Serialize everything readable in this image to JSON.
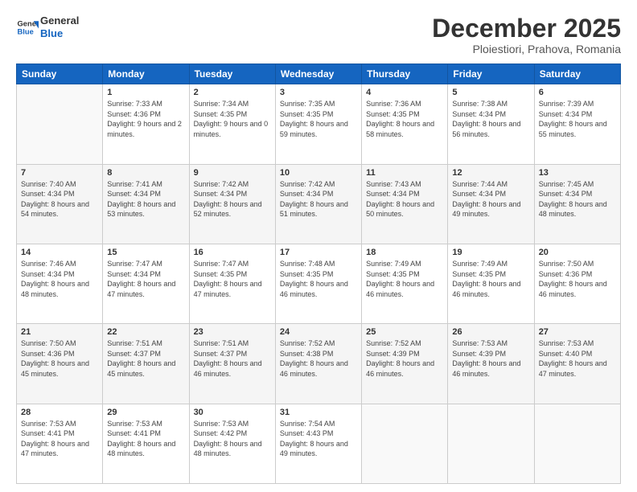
{
  "header": {
    "logo_line1": "General",
    "logo_line2": "Blue",
    "month": "December 2025",
    "location": "Ploiestiori, Prahova, Romania"
  },
  "weekdays": [
    "Sunday",
    "Monday",
    "Tuesday",
    "Wednesday",
    "Thursday",
    "Friday",
    "Saturday"
  ],
  "weeks": [
    [
      {
        "day": "",
        "sunrise": "",
        "sunset": "",
        "daylight": ""
      },
      {
        "day": "1",
        "sunrise": "Sunrise: 7:33 AM",
        "sunset": "Sunset: 4:36 PM",
        "daylight": "Daylight: 9 hours and 2 minutes."
      },
      {
        "day": "2",
        "sunrise": "Sunrise: 7:34 AM",
        "sunset": "Sunset: 4:35 PM",
        "daylight": "Daylight: 9 hours and 0 minutes."
      },
      {
        "day": "3",
        "sunrise": "Sunrise: 7:35 AM",
        "sunset": "Sunset: 4:35 PM",
        "daylight": "Daylight: 8 hours and 59 minutes."
      },
      {
        "day": "4",
        "sunrise": "Sunrise: 7:36 AM",
        "sunset": "Sunset: 4:35 PM",
        "daylight": "Daylight: 8 hours and 58 minutes."
      },
      {
        "day": "5",
        "sunrise": "Sunrise: 7:38 AM",
        "sunset": "Sunset: 4:34 PM",
        "daylight": "Daylight: 8 hours and 56 minutes."
      },
      {
        "day": "6",
        "sunrise": "Sunrise: 7:39 AM",
        "sunset": "Sunset: 4:34 PM",
        "daylight": "Daylight: 8 hours and 55 minutes."
      }
    ],
    [
      {
        "day": "7",
        "sunrise": "Sunrise: 7:40 AM",
        "sunset": "Sunset: 4:34 PM",
        "daylight": "Daylight: 8 hours and 54 minutes."
      },
      {
        "day": "8",
        "sunrise": "Sunrise: 7:41 AM",
        "sunset": "Sunset: 4:34 PM",
        "daylight": "Daylight: 8 hours and 53 minutes."
      },
      {
        "day": "9",
        "sunrise": "Sunrise: 7:42 AM",
        "sunset": "Sunset: 4:34 PM",
        "daylight": "Daylight: 8 hours and 52 minutes."
      },
      {
        "day": "10",
        "sunrise": "Sunrise: 7:42 AM",
        "sunset": "Sunset: 4:34 PM",
        "daylight": "Daylight: 8 hours and 51 minutes."
      },
      {
        "day": "11",
        "sunrise": "Sunrise: 7:43 AM",
        "sunset": "Sunset: 4:34 PM",
        "daylight": "Daylight: 8 hours and 50 minutes."
      },
      {
        "day": "12",
        "sunrise": "Sunrise: 7:44 AM",
        "sunset": "Sunset: 4:34 PM",
        "daylight": "Daylight: 8 hours and 49 minutes."
      },
      {
        "day": "13",
        "sunrise": "Sunrise: 7:45 AM",
        "sunset": "Sunset: 4:34 PM",
        "daylight": "Daylight: 8 hours and 48 minutes."
      }
    ],
    [
      {
        "day": "14",
        "sunrise": "Sunrise: 7:46 AM",
        "sunset": "Sunset: 4:34 PM",
        "daylight": "Daylight: 8 hours and 48 minutes."
      },
      {
        "day": "15",
        "sunrise": "Sunrise: 7:47 AM",
        "sunset": "Sunset: 4:34 PM",
        "daylight": "Daylight: 8 hours and 47 minutes."
      },
      {
        "day": "16",
        "sunrise": "Sunrise: 7:47 AM",
        "sunset": "Sunset: 4:35 PM",
        "daylight": "Daylight: 8 hours and 47 minutes."
      },
      {
        "day": "17",
        "sunrise": "Sunrise: 7:48 AM",
        "sunset": "Sunset: 4:35 PM",
        "daylight": "Daylight: 8 hours and 46 minutes."
      },
      {
        "day": "18",
        "sunrise": "Sunrise: 7:49 AM",
        "sunset": "Sunset: 4:35 PM",
        "daylight": "Daylight: 8 hours and 46 minutes."
      },
      {
        "day": "19",
        "sunrise": "Sunrise: 7:49 AM",
        "sunset": "Sunset: 4:35 PM",
        "daylight": "Daylight: 8 hours and 46 minutes."
      },
      {
        "day": "20",
        "sunrise": "Sunrise: 7:50 AM",
        "sunset": "Sunset: 4:36 PM",
        "daylight": "Daylight: 8 hours and 46 minutes."
      }
    ],
    [
      {
        "day": "21",
        "sunrise": "Sunrise: 7:50 AM",
        "sunset": "Sunset: 4:36 PM",
        "daylight": "Daylight: 8 hours and 45 minutes."
      },
      {
        "day": "22",
        "sunrise": "Sunrise: 7:51 AM",
        "sunset": "Sunset: 4:37 PM",
        "daylight": "Daylight: 8 hours and 45 minutes."
      },
      {
        "day": "23",
        "sunrise": "Sunrise: 7:51 AM",
        "sunset": "Sunset: 4:37 PM",
        "daylight": "Daylight: 8 hours and 46 minutes."
      },
      {
        "day": "24",
        "sunrise": "Sunrise: 7:52 AM",
        "sunset": "Sunset: 4:38 PM",
        "daylight": "Daylight: 8 hours and 46 minutes."
      },
      {
        "day": "25",
        "sunrise": "Sunrise: 7:52 AM",
        "sunset": "Sunset: 4:39 PM",
        "daylight": "Daylight: 8 hours and 46 minutes."
      },
      {
        "day": "26",
        "sunrise": "Sunrise: 7:53 AM",
        "sunset": "Sunset: 4:39 PM",
        "daylight": "Daylight: 8 hours and 46 minutes."
      },
      {
        "day": "27",
        "sunrise": "Sunrise: 7:53 AM",
        "sunset": "Sunset: 4:40 PM",
        "daylight": "Daylight: 8 hours and 47 minutes."
      }
    ],
    [
      {
        "day": "28",
        "sunrise": "Sunrise: 7:53 AM",
        "sunset": "Sunset: 4:41 PM",
        "daylight": "Daylight: 8 hours and 47 minutes."
      },
      {
        "day": "29",
        "sunrise": "Sunrise: 7:53 AM",
        "sunset": "Sunset: 4:41 PM",
        "daylight": "Daylight: 8 hours and 48 minutes."
      },
      {
        "day": "30",
        "sunrise": "Sunrise: 7:53 AM",
        "sunset": "Sunset: 4:42 PM",
        "daylight": "Daylight: 8 hours and 48 minutes."
      },
      {
        "day": "31",
        "sunrise": "Sunrise: 7:54 AM",
        "sunset": "Sunset: 4:43 PM",
        "daylight": "Daylight: 8 hours and 49 minutes."
      },
      {
        "day": "",
        "sunrise": "",
        "sunset": "",
        "daylight": ""
      },
      {
        "day": "",
        "sunrise": "",
        "sunset": "",
        "daylight": ""
      },
      {
        "day": "",
        "sunrise": "",
        "sunset": "",
        "daylight": ""
      }
    ]
  ]
}
